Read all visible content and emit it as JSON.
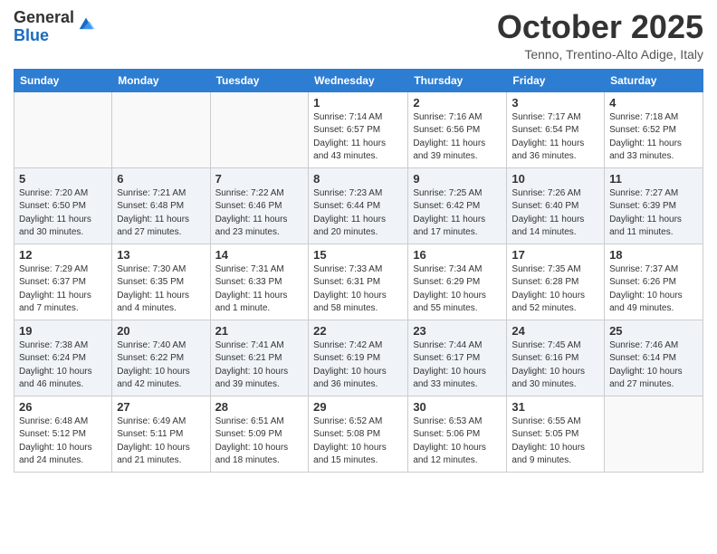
{
  "header": {
    "logo": {
      "line1": "General",
      "line2": "Blue"
    },
    "title": "October 2025",
    "location": "Tenno, Trentino-Alto Adige, Italy"
  },
  "weekdays": [
    "Sunday",
    "Monday",
    "Tuesday",
    "Wednesday",
    "Thursday",
    "Friday",
    "Saturday"
  ],
  "weeks": [
    [
      {
        "day": "",
        "info": ""
      },
      {
        "day": "",
        "info": ""
      },
      {
        "day": "",
        "info": ""
      },
      {
        "day": "1",
        "info": "Sunrise: 7:14 AM\nSunset: 6:57 PM\nDaylight: 11 hours and 43 minutes."
      },
      {
        "day": "2",
        "info": "Sunrise: 7:16 AM\nSunset: 6:56 PM\nDaylight: 11 hours and 39 minutes."
      },
      {
        "day": "3",
        "info": "Sunrise: 7:17 AM\nSunset: 6:54 PM\nDaylight: 11 hours and 36 minutes."
      },
      {
        "day": "4",
        "info": "Sunrise: 7:18 AM\nSunset: 6:52 PM\nDaylight: 11 hours and 33 minutes."
      }
    ],
    [
      {
        "day": "5",
        "info": "Sunrise: 7:20 AM\nSunset: 6:50 PM\nDaylight: 11 hours and 30 minutes."
      },
      {
        "day": "6",
        "info": "Sunrise: 7:21 AM\nSunset: 6:48 PM\nDaylight: 11 hours and 27 minutes."
      },
      {
        "day": "7",
        "info": "Sunrise: 7:22 AM\nSunset: 6:46 PM\nDaylight: 11 hours and 23 minutes."
      },
      {
        "day": "8",
        "info": "Sunrise: 7:23 AM\nSunset: 6:44 PM\nDaylight: 11 hours and 20 minutes."
      },
      {
        "day": "9",
        "info": "Sunrise: 7:25 AM\nSunset: 6:42 PM\nDaylight: 11 hours and 17 minutes."
      },
      {
        "day": "10",
        "info": "Sunrise: 7:26 AM\nSunset: 6:40 PM\nDaylight: 11 hours and 14 minutes."
      },
      {
        "day": "11",
        "info": "Sunrise: 7:27 AM\nSunset: 6:39 PM\nDaylight: 11 hours and 11 minutes."
      }
    ],
    [
      {
        "day": "12",
        "info": "Sunrise: 7:29 AM\nSunset: 6:37 PM\nDaylight: 11 hours and 7 minutes."
      },
      {
        "day": "13",
        "info": "Sunrise: 7:30 AM\nSunset: 6:35 PM\nDaylight: 11 hours and 4 minutes."
      },
      {
        "day": "14",
        "info": "Sunrise: 7:31 AM\nSunset: 6:33 PM\nDaylight: 11 hours and 1 minute."
      },
      {
        "day": "15",
        "info": "Sunrise: 7:33 AM\nSunset: 6:31 PM\nDaylight: 10 hours and 58 minutes."
      },
      {
        "day": "16",
        "info": "Sunrise: 7:34 AM\nSunset: 6:29 PM\nDaylight: 10 hours and 55 minutes."
      },
      {
        "day": "17",
        "info": "Sunrise: 7:35 AM\nSunset: 6:28 PM\nDaylight: 10 hours and 52 minutes."
      },
      {
        "day": "18",
        "info": "Sunrise: 7:37 AM\nSunset: 6:26 PM\nDaylight: 10 hours and 49 minutes."
      }
    ],
    [
      {
        "day": "19",
        "info": "Sunrise: 7:38 AM\nSunset: 6:24 PM\nDaylight: 10 hours and 46 minutes."
      },
      {
        "day": "20",
        "info": "Sunrise: 7:40 AM\nSunset: 6:22 PM\nDaylight: 10 hours and 42 minutes."
      },
      {
        "day": "21",
        "info": "Sunrise: 7:41 AM\nSunset: 6:21 PM\nDaylight: 10 hours and 39 minutes."
      },
      {
        "day": "22",
        "info": "Sunrise: 7:42 AM\nSunset: 6:19 PM\nDaylight: 10 hours and 36 minutes."
      },
      {
        "day": "23",
        "info": "Sunrise: 7:44 AM\nSunset: 6:17 PM\nDaylight: 10 hours and 33 minutes."
      },
      {
        "day": "24",
        "info": "Sunrise: 7:45 AM\nSunset: 6:16 PM\nDaylight: 10 hours and 30 minutes."
      },
      {
        "day": "25",
        "info": "Sunrise: 7:46 AM\nSunset: 6:14 PM\nDaylight: 10 hours and 27 minutes."
      }
    ],
    [
      {
        "day": "26",
        "info": "Sunrise: 6:48 AM\nSunset: 5:12 PM\nDaylight: 10 hours and 24 minutes."
      },
      {
        "day": "27",
        "info": "Sunrise: 6:49 AM\nSunset: 5:11 PM\nDaylight: 10 hours and 21 minutes."
      },
      {
        "day": "28",
        "info": "Sunrise: 6:51 AM\nSunset: 5:09 PM\nDaylight: 10 hours and 18 minutes."
      },
      {
        "day": "29",
        "info": "Sunrise: 6:52 AM\nSunset: 5:08 PM\nDaylight: 10 hours and 15 minutes."
      },
      {
        "day": "30",
        "info": "Sunrise: 6:53 AM\nSunset: 5:06 PM\nDaylight: 10 hours and 12 minutes."
      },
      {
        "day": "31",
        "info": "Sunrise: 6:55 AM\nSunset: 5:05 PM\nDaylight: 10 hours and 9 minutes."
      },
      {
        "day": "",
        "info": ""
      }
    ]
  ]
}
